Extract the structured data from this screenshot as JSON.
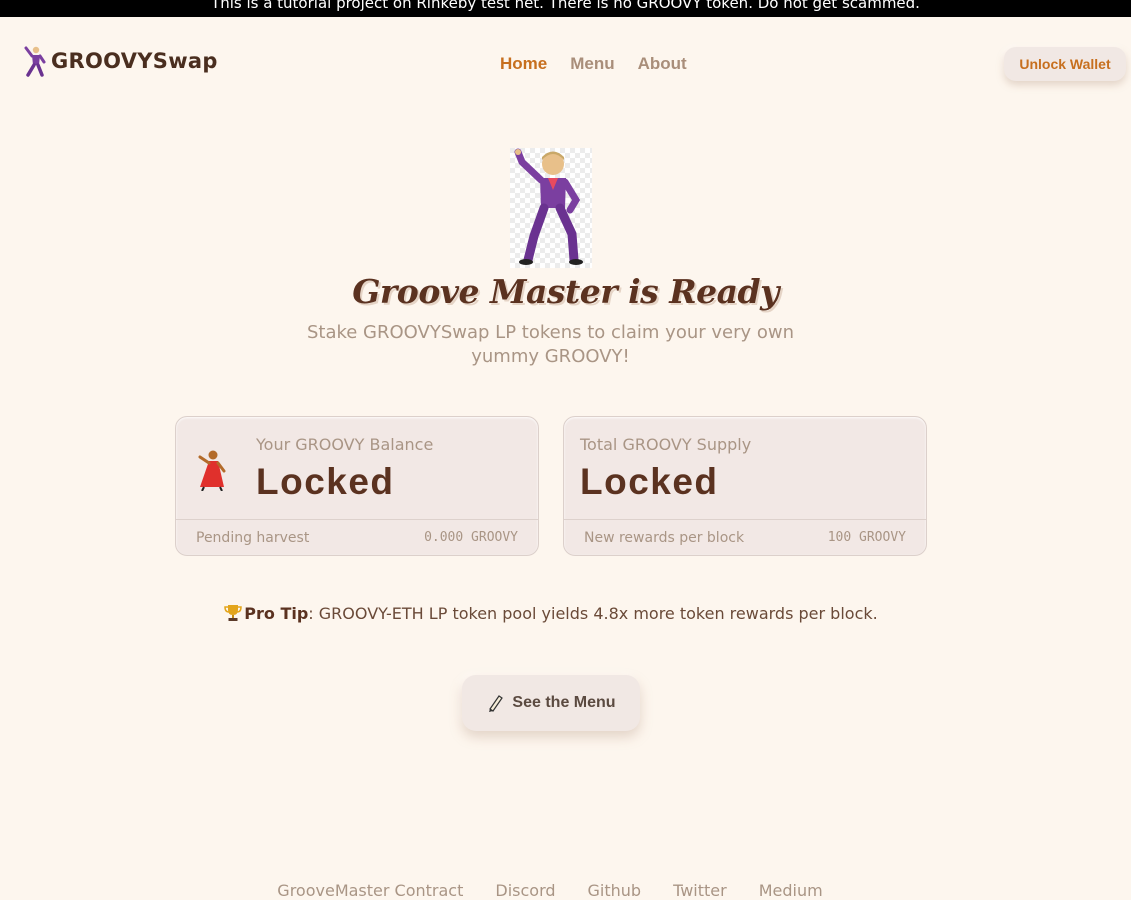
{
  "banner": {
    "text": "This is a tutorial project on Rinkeby test net. There is no GROOVY token. Do not get scammed."
  },
  "header": {
    "logo_text": "GROOVYSwap",
    "logo_icon": "dancer-man-icon",
    "nav": [
      {
        "label": "Home",
        "active": true
      },
      {
        "label": "Menu",
        "active": false
      },
      {
        "label": "About",
        "active": false
      }
    ],
    "unlock_label": "Unlock Wallet"
  },
  "hero": {
    "image_icon": "dancing-man-icon",
    "title": "Groove Master is Ready",
    "subtitle": "Stake GROOVYSwap LP tokens to claim your very own yummy GROOVY!"
  },
  "cards": {
    "balance": {
      "icon": "dancer-woman-icon",
      "label": "Your GROOVY Balance",
      "value": "Locked",
      "footer_label": "Pending harvest",
      "footer_value": "0.000 GROOVY"
    },
    "supply": {
      "label": "Total GROOVY Supply",
      "value": "Locked",
      "footer_label": "New rewards per block",
      "footer_value": "100 GROOVY"
    }
  },
  "pro_tip": {
    "icon": "trophy-icon",
    "label": "Pro Tip",
    "text": ": GROOVY-ETH LP token pool yields 4.8x more token rewards per block."
  },
  "menu_button": {
    "icon": "menu-pen-icon",
    "label": "See the Menu"
  },
  "footer": {
    "links": [
      "GrooveMaster Contract",
      "Discord",
      "Github",
      "Twitter",
      "Medium"
    ]
  },
  "colors": {
    "background": "#fdf6ee",
    "accent": "#c76f1e",
    "text_dark": "#5b3220",
    "text_muted": "#a99585",
    "card_bg": "#f2e8e5"
  }
}
